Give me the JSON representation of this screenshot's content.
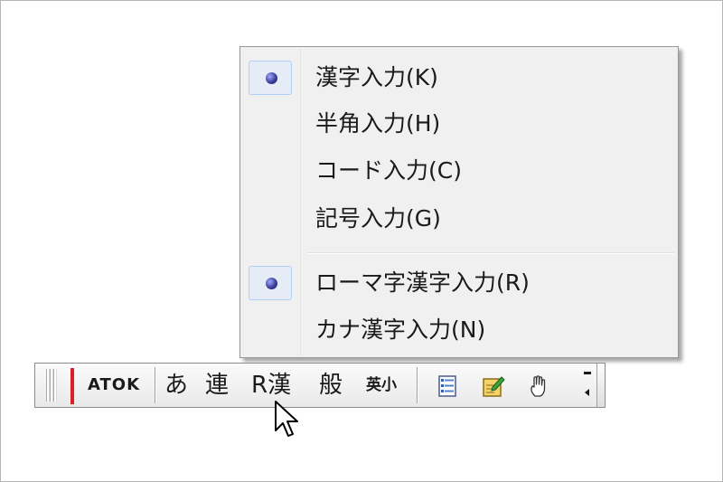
{
  "context_menu": {
    "items": [
      {
        "label": "漢字入力(K)",
        "checked": true
      },
      {
        "label": "半角入力(H)",
        "checked": false
      },
      {
        "label": "コード入力(C)",
        "checked": false
      },
      {
        "label": "記号入力(G)",
        "checked": false
      },
      {
        "label": "ローマ字漢字入力(R)",
        "checked": true
      },
      {
        "label": "カナ漢字入力(N)",
        "checked": false
      }
    ]
  },
  "toolbar": {
    "brand": "ATOK",
    "input_char_mode": "あ",
    "conversion_mode": "連",
    "romaji_kanji_mode": "R漢",
    "dictionary_mode": "般",
    "alphanumeric_mode": "英小",
    "icons": [
      "menu-list-icon",
      "memo-pad-icon",
      "hand-pointer-icon",
      "toolbar-collapse-icon"
    ]
  },
  "colors": {
    "menu_background": "#f0f0f0",
    "check_highlight": "#e6ecf5",
    "check_border": "#aecff7",
    "radio_dot": "#3c3f9a",
    "toolbar_red_bar": "#e02020"
  }
}
